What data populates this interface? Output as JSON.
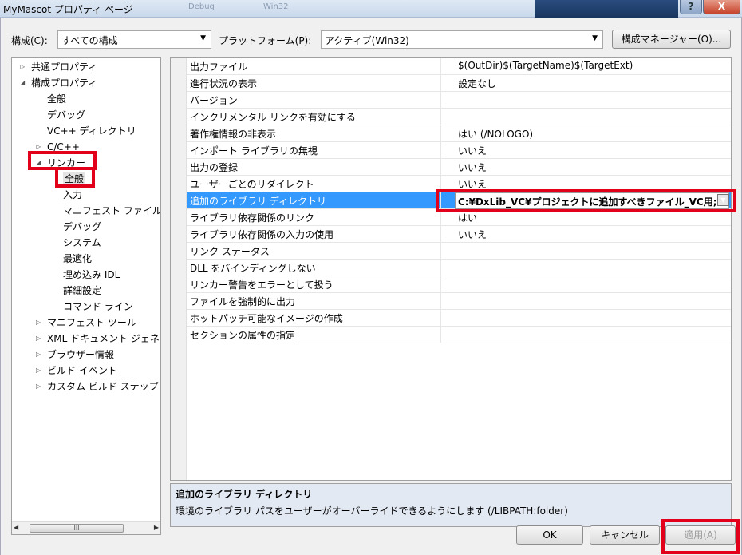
{
  "window": {
    "title": "MyMascot プロパティ ページ",
    "ghost_tabs": [
      "Debug",
      "Win32"
    ],
    "help_label": "?",
    "close_label": "X"
  },
  "toolbar": {
    "config_label": "構成(C):",
    "config_value": "すべての構成",
    "platform_label": "プラットフォーム(P):",
    "platform_value": "アクティブ(Win32)",
    "config_manager_label": "構成マネージャー(O)..."
  },
  "tree": {
    "common": "共通プロパティ",
    "config": "構成プロパティ",
    "general": "全般",
    "debug": "デバッグ",
    "vcdirs": "VC++ ディレクトリ",
    "cpp": "C/C++",
    "linker": "リンカー",
    "linker_items": [
      "全般",
      "入力",
      "マニフェスト ファイル",
      "デバッグ",
      "システム",
      "最適化",
      "埋め込み IDL",
      "詳細設定",
      "コマンド ライン"
    ],
    "manifest_tool": "マニフェスト ツール",
    "xml_doc": "XML ドキュメント ジェネ",
    "browser": "ブラウザー情報",
    "build_events": "ビルド イベント",
    "custom_build": "カスタム ビルド ステップ",
    "scroll_grip": "III"
  },
  "properties": [
    {
      "name": "出力ファイル",
      "value": "$(OutDir)$(TargetName)$(TargetExt)"
    },
    {
      "name": "進行状況の表示",
      "value": "設定なし"
    },
    {
      "name": "バージョン",
      "value": ""
    },
    {
      "name": "インクリメンタル リンクを有効にする",
      "value": ""
    },
    {
      "name": "著作権情報の非表示",
      "value": "はい (/NOLOGO)"
    },
    {
      "name": "インポート ライブラリの無視",
      "value": "いいえ"
    },
    {
      "name": "出力の登録",
      "value": "いいえ"
    },
    {
      "name": "ユーザーごとのリダイレクト",
      "value": "いいえ"
    },
    {
      "name": "追加のライブラリ ディレクトリ",
      "value": "C:¥DxLib_VC¥プロジェクトに追加すべきファイル_VC用;%("
    },
    {
      "name": "ライブラリ依存関係のリンク",
      "value": "はい"
    },
    {
      "name": "ライブラリ依存関係の入力の使用",
      "value": "いいえ"
    },
    {
      "name": "リンク ステータス",
      "value": ""
    },
    {
      "name": "DLL をバインディングしない",
      "value": ""
    },
    {
      "name": "リンカー警告をエラーとして扱う",
      "value": ""
    },
    {
      "name": "ファイルを強制的に出力",
      "value": ""
    },
    {
      "name": "ホットパッチ可能なイメージの作成",
      "value": ""
    },
    {
      "name": "セクションの属性の指定",
      "value": ""
    }
  ],
  "description": {
    "title": "追加のライブラリ ディレクトリ",
    "text": "環境のライブラリ パスをユーザーがオーバーライドできるようにします (/LIBPATH:folder)"
  },
  "buttons": {
    "ok": "OK",
    "cancel": "キャンセル",
    "apply": "適用(A)"
  },
  "colors": {
    "selection": "#3399ff",
    "highlight": "#e2001a"
  }
}
